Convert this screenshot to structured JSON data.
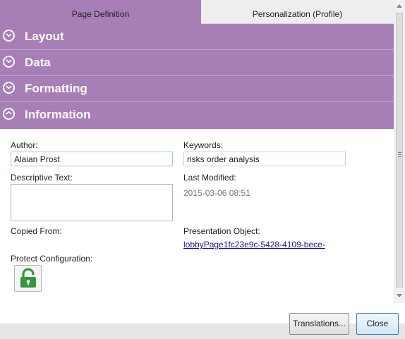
{
  "tabs": [
    {
      "label": "Page Definition",
      "active": true
    },
    {
      "label": "Personalization (Profile)",
      "active": false
    }
  ],
  "sections": [
    {
      "label": "Layout",
      "expanded": false
    },
    {
      "label": "Data",
      "expanded": false
    },
    {
      "label": "Formatting",
      "expanded": false
    },
    {
      "label": "Information",
      "expanded": true
    }
  ],
  "info": {
    "author_label": "Author:",
    "author_value": "Alaian Prost",
    "keywords_label": "Keywords:",
    "keywords_value": "risks order analysis",
    "descriptive_label": "Descriptive Text:",
    "descriptive_value": "",
    "last_modified_label": "Last Modified:",
    "last_modified_value": "2015-03-06 08:51",
    "copied_from_label": "Copied From:",
    "presentation_object_label": "Presentation Object:",
    "presentation_object_value": "lobbyPage1fc23e9c-5428-4109-bece-",
    "protect_label": "Protect Configuration:",
    "protect_icon": "unlocked-padlock-icon"
  },
  "footer": {
    "translations_label": "Translations...",
    "close_label": "Close"
  },
  "colors": {
    "accent": "#a77fb6",
    "link": "#1a0dab",
    "lock_green": "#2e9b3a"
  }
}
